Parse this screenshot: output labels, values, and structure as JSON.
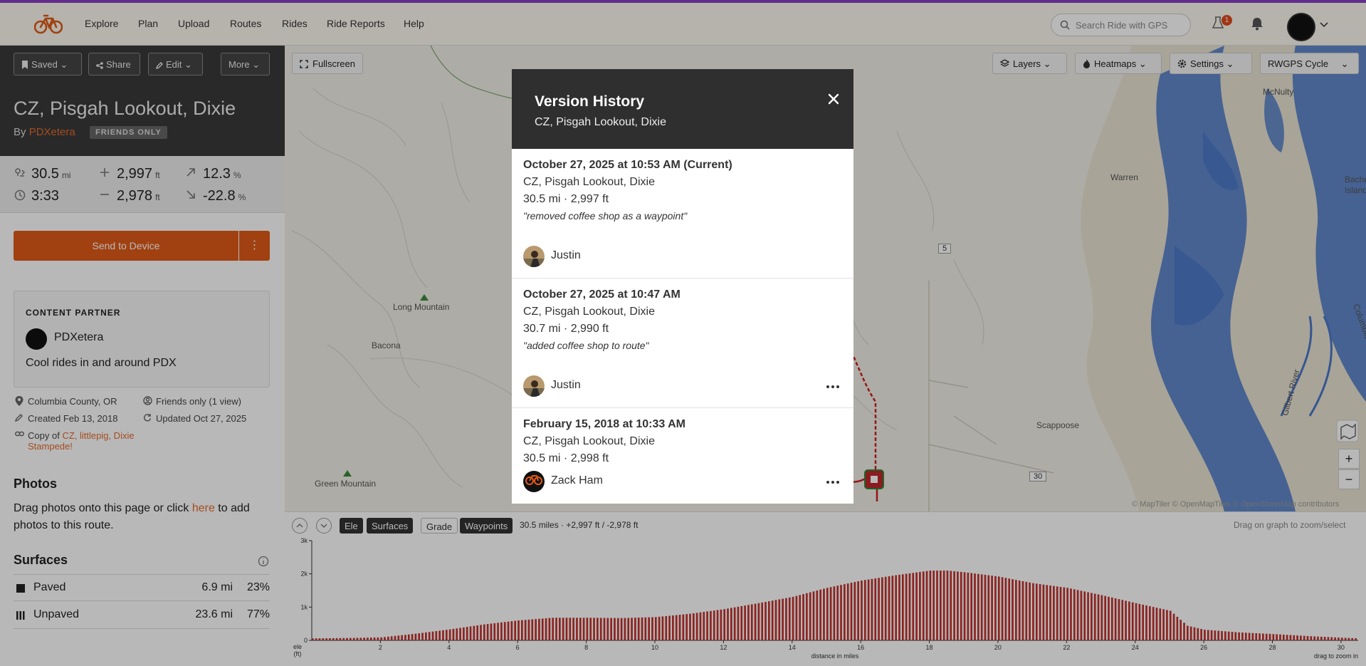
{
  "nav": {
    "items": [
      "Explore",
      "Plan",
      "Upload",
      "Routes",
      "Rides",
      "Ride Reports",
      "Help"
    ],
    "search_placeholder": "Search Ride with GPS",
    "alert_count": "1",
    "brand_color": "#e05a18",
    "accent_bar_color": "#8a3cc4"
  },
  "sidebar": {
    "toolbar": {
      "saved": "Saved",
      "share": "Share",
      "edit": "Edit",
      "more": "More"
    },
    "title": "CZ, Pisgah Lookout, Dixie",
    "by": "By",
    "author": "PDXetera",
    "visibility_badge": "FRIENDS ONLY",
    "stats": {
      "distance": "30.5",
      "distance_unit": "mi",
      "gain": "2,997",
      "gain_unit": "ft",
      "max_grade": "12.3",
      "max_grade_unit": "%",
      "moving_time": "3:33",
      "loss": "2,978",
      "loss_unit": "ft",
      "min_grade": "-22.8",
      "min_grade_unit": "%"
    },
    "send_label": "Send to Device",
    "send_more": "⋮",
    "partner": {
      "label": "CONTENT PARTNER",
      "name": "PDXetera",
      "description": "Cool rides in and around PDX"
    },
    "meta": {
      "location": "Columbia County, OR",
      "privacy": "Friends only (1 view)",
      "created": "Created Feb 13, 2018",
      "updated": "Updated Oct 27, 2025",
      "copy_prefix": "Copy of",
      "copy_link_1": "CZ, littlepig, Dixie",
      "copy_link_2": "Stampede!"
    },
    "photos": {
      "heading": "Photos",
      "text_before": "Drag photos onto this page or click",
      "link": "here",
      "text_after": "to add photos to this route."
    },
    "surfaces": {
      "heading": "Surfaces",
      "rows": [
        {
          "name": "Paved",
          "distance": "6.9 mi",
          "percent": "23%"
        },
        {
          "name": "Unpaved",
          "distance": "23.6 mi",
          "percent": "77%"
        }
      ]
    }
  },
  "map": {
    "fullscreen": "Fullscreen",
    "layers": "Layers",
    "heatmaps": "Heatmaps",
    "settings": "Settings",
    "style": "RWGPS Cycle",
    "labels": {
      "mcnulty": "McNulty",
      "warren": "Warren",
      "bache": "Bache",
      "island": "Island",
      "long_mountain": "Long Mountain",
      "bacona": "Bacona",
      "scappoose": "Scappoose",
      "green_mountain": "Green Mountain",
      "gilbert_river": "Gilbert River",
      "columbia": "Columbia"
    },
    "markers": {
      "m5": "5",
      "m30": "30"
    },
    "zoom_in": "+",
    "zoom_out": "−",
    "attribution": "© MapTiler © OpenMapTiles © OpenStreetMap contributors",
    "route_color": "#cc1f1f"
  },
  "elevation": {
    "buttons": [
      "Ele",
      "Surfaces",
      "Grade",
      "Waypoints"
    ],
    "summary": "30.5 miles · +2,997 ft / -2,978 ft",
    "hint": "Drag on graph to zoom/select",
    "y_labels": [
      "3k",
      "2k",
      "1k",
      "0"
    ],
    "y_axis_title_1": "ele",
    "y_axis_title_2": "(ft)",
    "x_labels": [
      "2",
      "4",
      "6",
      "8",
      "10",
      "12",
      "14",
      "16",
      "18",
      "20",
      "22",
      "24",
      "26",
      "28",
      "30"
    ],
    "x_axis_title": "distance in miles",
    "zoom_hint": "drag to zoom in"
  },
  "chart_data": {
    "type": "bar",
    "xlabel": "distance in miles",
    "ylabel": "ele (ft)",
    "xlim": [
      0,
      30.5
    ],
    "ylim": [
      0,
      3000
    ],
    "x": [
      0,
      1,
      2,
      3,
      4,
      5,
      6,
      7,
      8,
      9,
      10,
      11,
      12,
      13,
      14,
      15,
      16,
      17,
      18,
      18.5,
      19,
      20,
      21,
      22,
      23,
      24,
      25,
      25.5,
      26,
      27,
      28,
      29,
      30,
      30.5
    ],
    "y": [
      60,
      70,
      90,
      200,
      330,
      480,
      600,
      680,
      680,
      670,
      700,
      800,
      940,
      1120,
      1310,
      1580,
      1800,
      1960,
      2100,
      2100,
      2050,
      1920,
      1720,
      1580,
      1360,
      1120,
      890,
      440,
      320,
      240,
      190,
      130,
      80,
      60
    ]
  },
  "modal": {
    "title": "Version History",
    "subtitle": "CZ, Pisgah Lookout, Dixie",
    "versions": [
      {
        "time": "October 27, 2025 at 10:53 AM (Current)",
        "name": "CZ, Pisgah Lookout, Dixie",
        "stats": "30.5 mi · 2,997 ft",
        "comment": "\"removed coffee shop as a waypoint\"",
        "user": "Justin"
      },
      {
        "time": "October 27, 2025 at 10:47 AM",
        "name": "CZ, Pisgah Lookout, Dixie",
        "stats": "30.7 mi · 2,990 ft",
        "comment": "\"added coffee shop to route\"",
        "user": "Justin"
      },
      {
        "time": "February 15, 2018 at 10:33 AM",
        "name": "CZ, Pisgah Lookout, Dixie",
        "stats": "30.5 mi · 2,998 ft",
        "user": "Zack Ham"
      }
    ]
  }
}
